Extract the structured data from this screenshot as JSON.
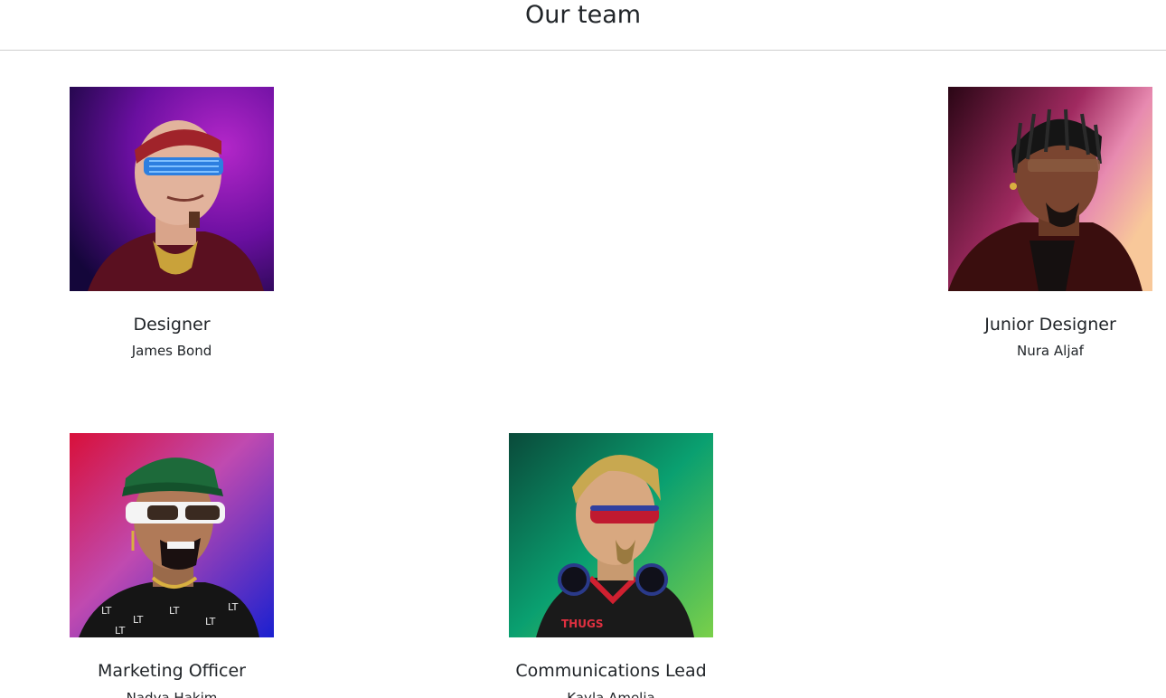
{
  "header": {
    "title": "Our team"
  },
  "members": [
    {
      "role": "Designer",
      "name": "James Bond",
      "avatar_icon": "bald-man-blue-shutter-shades-avatar",
      "bg": [
        "#2a0a5e",
        "#8a1aa8"
      ]
    },
    {
      "role": "Junior Designer",
      "name": "Nura Aljaf",
      "avatar_icon": "braided-hair-man-leather-jacket-avatar",
      "bg": [
        "#3a0c22",
        "#f4b48a"
      ]
    },
    {
      "role": "Marketing Officer",
      "name": "Nadya Hakim",
      "avatar_icon": "green-cap-white-sunglasses-avatar",
      "bg": [
        "#d4123f",
        "#2a20c8"
      ]
    },
    {
      "role": "Communications Lead",
      "name": "Kayla Amelia",
      "avatar_icon": "blonde-man-headphones-jersey-avatar",
      "bg": [
        "#0a5a4a",
        "#6cd25a"
      ]
    }
  ]
}
